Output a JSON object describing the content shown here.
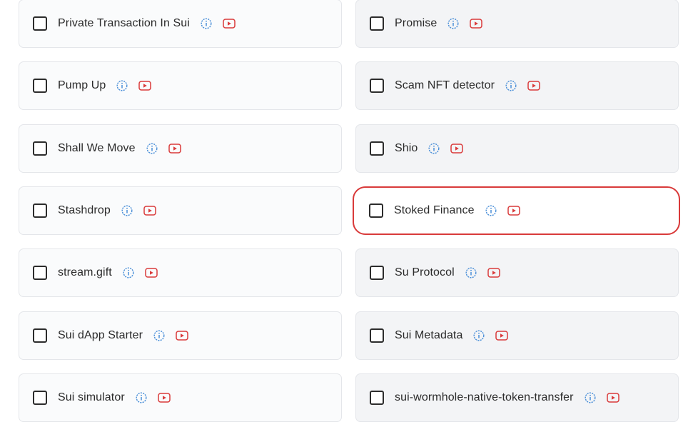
{
  "colors": {
    "info": "#4a8fd8",
    "video": "#d93a3a",
    "highlight_border": "#d93a3a"
  },
  "items": [
    {
      "label": "Private Transaction In Sui",
      "checked": false
    },
    {
      "label": "Promise",
      "checked": false
    },
    {
      "label": "Pump Up",
      "checked": false
    },
    {
      "label": "Scam NFT detector",
      "checked": false
    },
    {
      "label": "Shall We Move",
      "checked": false
    },
    {
      "label": "Shio",
      "checked": false
    },
    {
      "label": "Stashdrop",
      "checked": false
    },
    {
      "label": "Stoked Finance",
      "checked": false,
      "highlighted": true
    },
    {
      "label": "stream.gift",
      "checked": false
    },
    {
      "label": "Su Protocol",
      "checked": false
    },
    {
      "label": "Sui dApp Starter",
      "checked": false
    },
    {
      "label": "Sui Metadata",
      "checked": false
    },
    {
      "label": "Sui simulator",
      "checked": false
    },
    {
      "label": "sui-wormhole-native-token-transfer",
      "checked": false
    }
  ],
  "icons": {
    "info": "info-circle-icon",
    "video": "video-play-icon"
  }
}
